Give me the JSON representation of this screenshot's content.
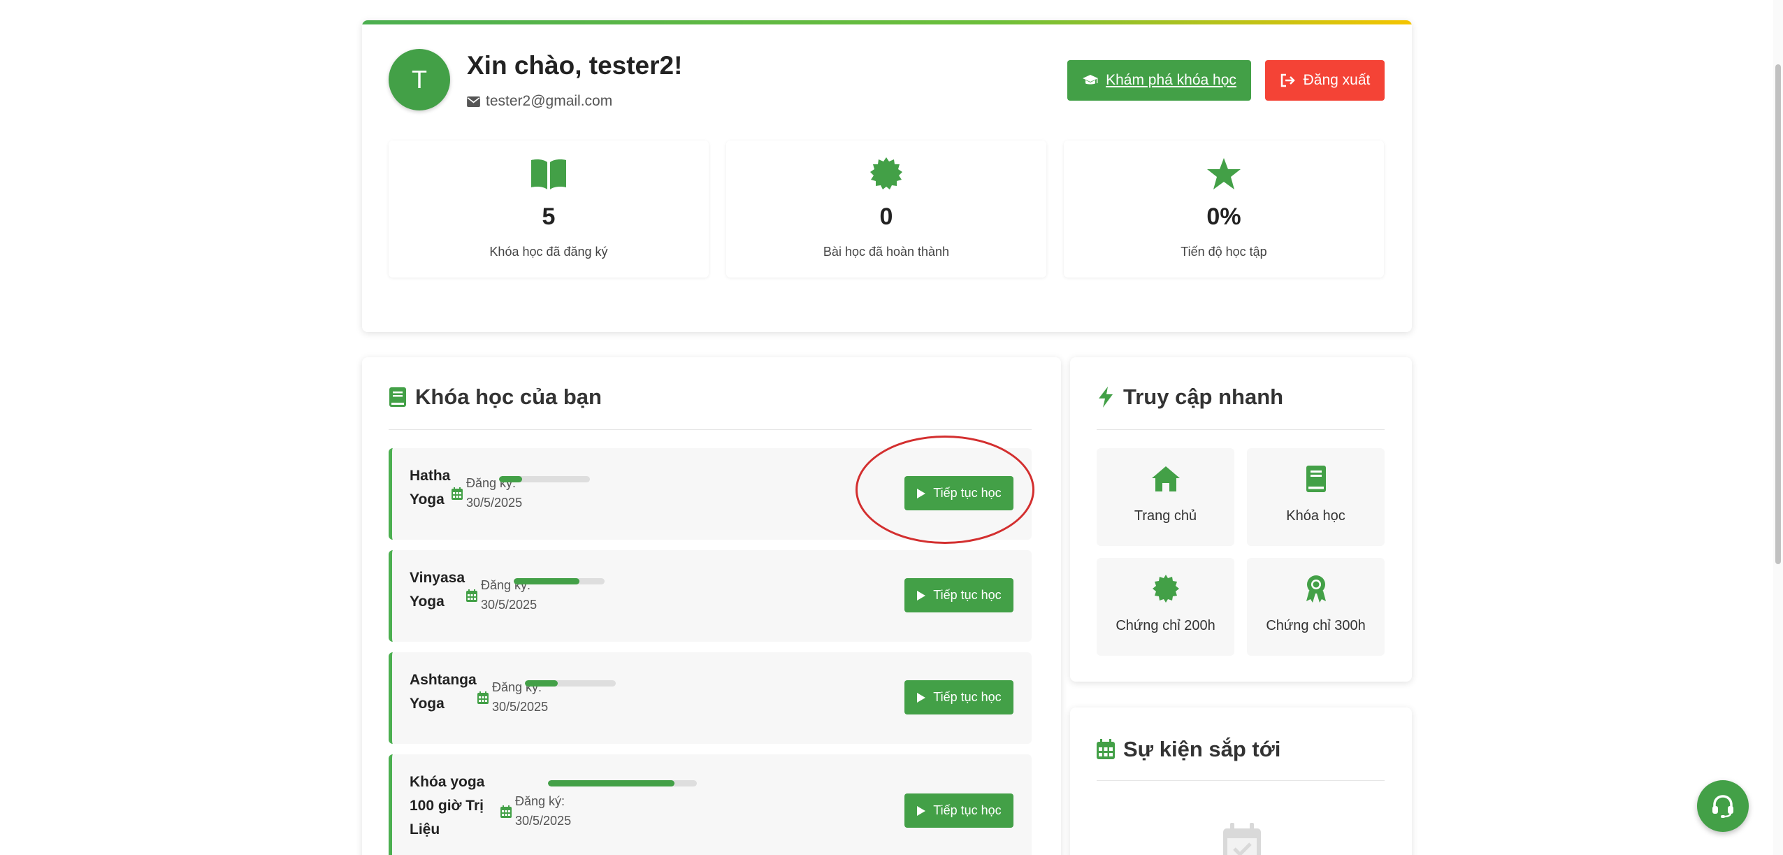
{
  "profile": {
    "avatar_initial": "T",
    "greeting": "Xin chào, tester2!",
    "email": "tester2@gmail.com",
    "explore_label": "Khám phá khóa học",
    "logout_label": "Đăng xuất"
  },
  "stats": [
    {
      "icon": "book-open-icon",
      "value": "5",
      "label": "Khóa học đã đăng ký"
    },
    {
      "icon": "certificate-icon",
      "value": "0",
      "label": "Bài học đã hoàn thành"
    },
    {
      "icon": "star-icon",
      "value": "0%",
      "label": "Tiến độ học tập"
    }
  ],
  "courses_section": {
    "title": "Khóa học của bạn",
    "register_label": "Đăng ký:",
    "continue_label": "Tiếp tục học",
    "items": [
      {
        "name_lines": [
          "Hatha",
          "Yoga"
        ],
        "date": "30/5/2025",
        "progress": 0.25
      },
      {
        "name_lines": [
          "Vinyasa",
          "Yoga"
        ],
        "date": "30/5/2025",
        "progress": 0.72
      },
      {
        "name_lines": [
          "Ashtanga",
          "Yoga"
        ],
        "date": "30/5/2025",
        "progress": 0.36
      },
      {
        "name_lines": [
          "Khóa yoga",
          "100 giờ Trị",
          "Liệu"
        ],
        "date": "30/5/2025",
        "progress": 0.85
      }
    ]
  },
  "quick_access": {
    "title": "Truy cập nhanh",
    "tiles": [
      {
        "icon": "home-icon",
        "label": "Trang chủ"
      },
      {
        "icon": "book-icon",
        "label": "Khóa học"
      },
      {
        "icon": "certificate-icon",
        "label": "Chứng chỉ 200h"
      },
      {
        "icon": "award-icon",
        "label": "Chứng chỉ 300h"
      }
    ]
  },
  "events": {
    "title": "Sự kiện sắp tới"
  },
  "colors": {
    "primary": "#43a047",
    "danger": "#f44336",
    "highlight": "#d32f2f"
  }
}
